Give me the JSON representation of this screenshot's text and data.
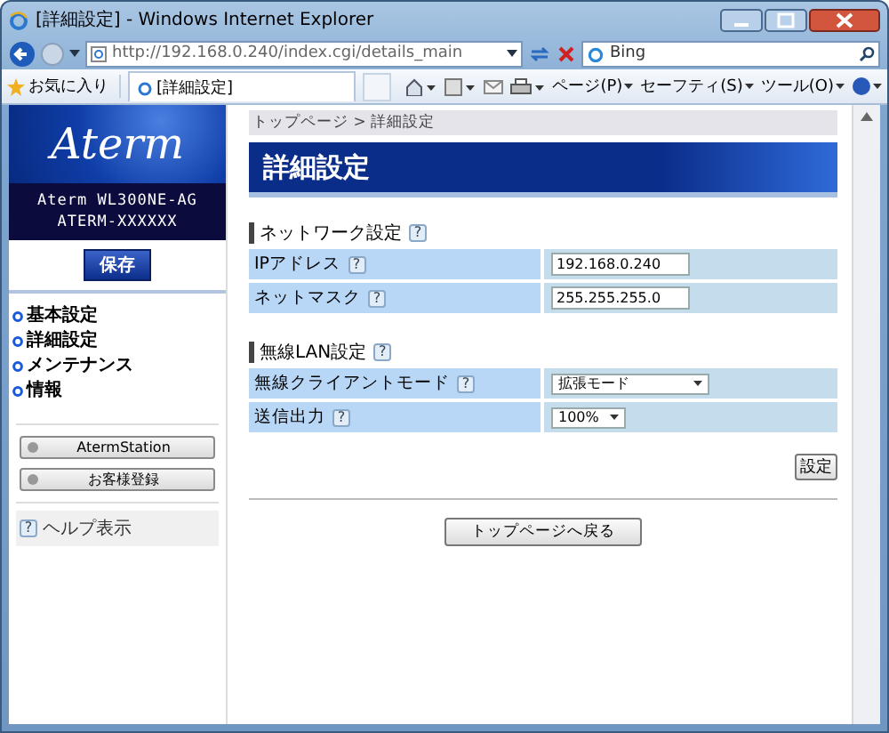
{
  "window": {
    "title": "[詳細設定] - Windows Internet Explorer"
  },
  "address_bar": {
    "url": "http://192.168.0.240/index.cgi/details_main"
  },
  "search": {
    "placeholder": "Bing"
  },
  "favorites": {
    "label": "お気に入り"
  },
  "tab": {
    "label": "[詳細設定]"
  },
  "menus": [
    "ページ(P)",
    "セーフティ(S)",
    "ツール(O)"
  ],
  "sidebar": {
    "logo": "Aterm",
    "model": "Aterm WL300NE-AG",
    "device_id": "ATERM-XXXXXX",
    "save_button": "保存",
    "nav": [
      "基本設定",
      "詳細設定",
      "メンテナンス",
      "情報"
    ],
    "link_buttons": [
      "AtermStation",
      "お客様登録"
    ],
    "help": {
      "icon": "?",
      "label": "ヘルプ表示"
    }
  },
  "main": {
    "breadcrumb": "トップページ > 詳細設定",
    "title": "詳細設定",
    "sections": [
      {
        "heading": "ネットワーク設定",
        "help": "?",
        "rows": [
          {
            "label": "IPアドレス",
            "help": "?",
            "kind": "text",
            "value": "192.168.0.240"
          },
          {
            "label": "ネットマスク",
            "help": "?",
            "kind": "text",
            "value": "255.255.255.0"
          }
        ]
      },
      {
        "heading": "無線LAN設定",
        "help": "?",
        "rows": [
          {
            "label": "無線クライアントモード",
            "help": "?",
            "kind": "select",
            "value": "拡張モード"
          },
          {
            "label": "送信出力",
            "help": "?",
            "kind": "select",
            "value": "100%"
          }
        ]
      }
    ],
    "apply_button": "設定",
    "back_button": "トップページへ戻る"
  }
}
